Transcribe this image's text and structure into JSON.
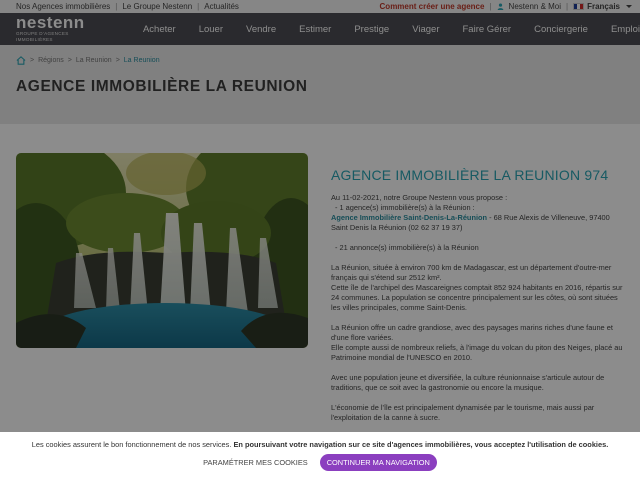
{
  "topbar": {
    "links": [
      "Nos Agences immobilières",
      "Le Groupe Nestenn",
      "Actualités"
    ],
    "create_agency": "Comment créer une agence",
    "account": "Nestenn & Moi",
    "language": "Français",
    "user_icon": "user-icon",
    "flag_icon": "french-flag-icon"
  },
  "nav": {
    "logo_name": "nestenn",
    "logo_sub": "GROUPE D'AGENCES IMMOBILIÈRES",
    "items": [
      "Acheter",
      "Louer",
      "Vendre",
      "Estimer",
      "Prestige",
      "Viager",
      "Faire Gérer",
      "Conciergerie",
      "Emploi"
    ]
  },
  "breadcrumb": {
    "home_icon": "home-icon",
    "items": [
      "Régions",
      "La Reunion",
      "La Reunion"
    ]
  },
  "page_title": "AGENCE IMMOBILIÈRE LA REUNION",
  "content": {
    "heading": "AGENCE IMMOBILIÈRE LA REUNION 974",
    "p1_line1": "Au 11-02-2021, notre Groupe Nestenn vous propose :",
    "p1_line2": "- 1 agence(s) immobilière(s) à la Réunion :",
    "agency_link": "Agence Immobilière Saint-Denis-La-Réunion",
    "agency_address": " - 68 Rue Alexis de Villeneuve, 97400 Saint Denis la Réunion (02 62 37 19 37)",
    "p2": "- 21 annonce(s) immobilière(s) à la Réunion",
    "p3": "La Réunion, située à environ 700 km de Madagascar, est un département d'outre-mer français qui s'étend sur 2512 km².",
    "p4": "Cette île de l'archipel des Mascareignes comptait 852 924 habitants en 2016, répartis sur 24 communes. La population se concentre principalement sur les côtes, où sont situées les villes principales, comme Saint-Denis.",
    "p5": "La Réunion offre un cadre grandiose, avec des paysages marins riches d'une faune et d'une flore variées.",
    "p6": "Elle compte aussi de nombreux reliefs, à l'image du volcan du piton des Neiges, placé au Patrimoine mondial de l'UNESCO en 2010.",
    "p7": "Avec une population jeune et diversifiée, la culture réunionnaise s'articule autour de traditions, que ce soit avec la gastronomie ou encore la musique.",
    "p8": "L'économie de l'île est principalement dynamisée par le tourisme, mais aussi par l'exploitation de la canne à sucre."
  },
  "cookie": {
    "text_normal": "Les cookies assurent le bon fonctionnement de nos services. ",
    "text_bold": "En poursuivant votre navigation sur ce site d'agences immobilières, vous acceptez l'utilisation de cookies.",
    "params_label": "PARAMÉTRER MES COOKIES",
    "continue_label": "CONTINUER MA NAVIGATION"
  },
  "colors": {
    "accent": "#2aa5b5",
    "nav_bg": "#4e4e54",
    "cookie_button": "#8b3fbf",
    "create_link": "#c0392b"
  }
}
